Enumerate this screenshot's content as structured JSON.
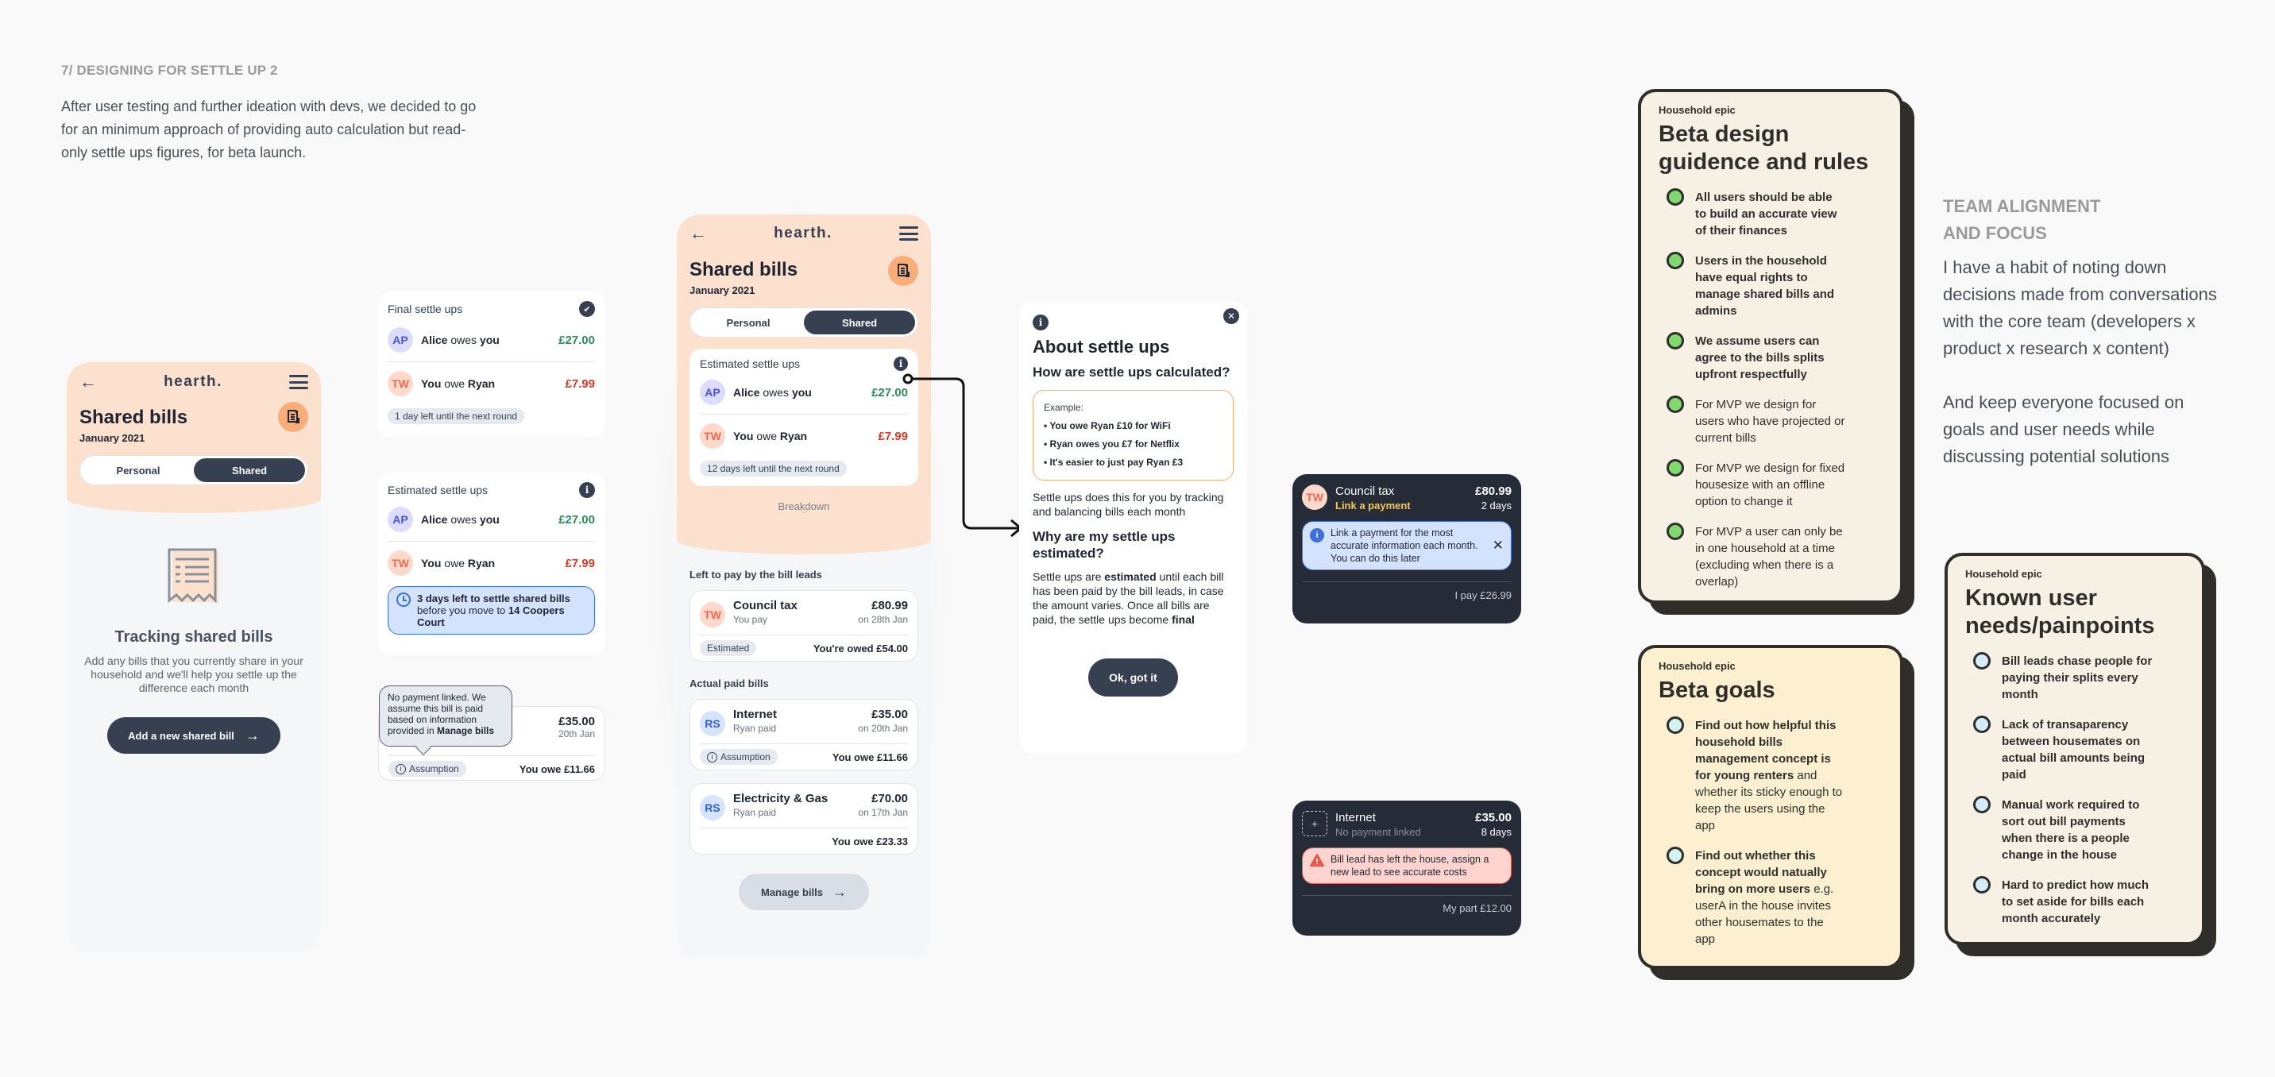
{
  "intro": {
    "title": "7/ DESIGNING FOR SETTLE UP 2",
    "body": "After user testing and further ideation with devs, we decided to go for an minimum approach of providing auto calculation but read-only settle ups figures, for beta launch."
  },
  "app": {
    "brand": "hearth.",
    "page_title": "Shared bills",
    "date": "January 2021",
    "tabs": [
      "Personal",
      "Shared"
    ],
    "active_tab": "Shared"
  },
  "empty_state": {
    "title": "Tracking shared bills",
    "body": "Add any bills that you currently share in your household and we'll help you settle up the difference each month",
    "cta": "Add a new shared bill"
  },
  "final_card": {
    "title": "Final settle ups",
    "rows": [
      {
        "initials": "AP",
        "name": "Alice",
        "verb": " owes ",
        "target": "you",
        "amount": "£27.00"
      },
      {
        "initials": "TW",
        "name": "You",
        "verb": " owe ",
        "target": "Ryan",
        "amount": "£7.99"
      }
    ],
    "pill": "1 day left until the next round"
  },
  "estimated_card": {
    "title": "Estimated settle ups",
    "rows": [
      {
        "initials": "AP",
        "name": "Alice",
        "verb": " owes ",
        "target": "you",
        "amount": "£27.00"
      },
      {
        "initials": "TW",
        "name": "You",
        "verb": " owe ",
        "target": "Ryan",
        "amount": "£7.99"
      }
    ],
    "notice_bold": "3 days left to settle shared bills",
    "notice_rest": " before you move to ",
    "notice_place": "14 Coopers Court"
  },
  "assumption_card": {
    "tooltip": "No payment linked. We assume this bill is paid based on information provided in ",
    "tooltip_bold": "Manage bills",
    "amount": "£35.00",
    "date": "20th Jan",
    "pill": "Assumption",
    "owe": "You owe £11.66"
  },
  "main_phone": {
    "estimated_title": "Estimated settle ups",
    "rows": [
      {
        "initials": "AP",
        "name": "Alice",
        "verb": " owes ",
        "target": "you",
        "amount": "£27.00"
      },
      {
        "initials": "TW",
        "name": "You",
        "verb": " owe ",
        "target": "Ryan",
        "amount": "£7.99"
      }
    ],
    "pill": "12 days left until the next round",
    "breakdown": "Breakdown",
    "section_left": "Left to pay by the bill leads",
    "section_paid": "Actual paid bills",
    "bills": [
      {
        "initials": "TW",
        "name": "Council tax",
        "sub": "You pay",
        "amount": "£80.99",
        "date": "on 28th Jan",
        "pill": "Estimated",
        "footer": "You're owed £54.00"
      },
      {
        "initials": "RS",
        "name": "Internet",
        "sub": "Ryan paid",
        "amount": "£35.00",
        "date": "on 20th Jan",
        "pill": "Assumption",
        "footer": "You owe £11.66"
      },
      {
        "initials": "RS",
        "name": "Electricity & Gas",
        "sub": "Ryan paid",
        "amount": "£70.00",
        "date": "on 17th Jan",
        "pill": "",
        "footer": "You owe £23.33"
      }
    ],
    "manage": "Manage bills"
  },
  "modal": {
    "title": "About settle ups",
    "q1": "How are settle ups calculated?",
    "example_label": "Example:",
    "examples": [
      "• You owe Ryan £10 for WiFi",
      "• Ryan owes you £7 for Netflix",
      "• It's easier to just pay Ryan £3"
    ],
    "a1": "Settle ups does this for you by tracking and balancing bills each month",
    "q2": "Why are my settle ups estimated?",
    "a2_1": "Settle ups are ",
    "a2_bold": "estimated",
    "a2_2": " until each bill has been paid by the bill leads, in case the amount varies. Once all bills are paid, the settle ups become ",
    "a2_final": "final",
    "button": "Ok, got it"
  },
  "dark_council": {
    "initials": "TW",
    "name": "Council tax",
    "link": "Link a payment",
    "amount": "£80.99",
    "days": "2 days",
    "info": "Link a payment for the most accurate information each month. You can do this later",
    "footer": "I pay £26.99"
  },
  "dark_internet": {
    "name": "Internet",
    "sub": "No payment linked",
    "amount": "£35.00",
    "days": "8 days",
    "warning": "Bill lead has left the house, assign a new lead to see accurate costs",
    "footer": "My part £12.00"
  },
  "epic_rules": {
    "tag": "Household epic",
    "title": "Beta design guidence and rules",
    "items": [
      {
        "bold": "All users should be able to build an accurate view of their finances",
        "rest": ""
      },
      {
        "bold": "Users in the household have equal rights to manage shared bills and admins",
        "rest": ""
      },
      {
        "bold": "We assume users can agree to the bills splits upfront respectfully",
        "rest": ""
      },
      {
        "bold": "",
        "rest": "For MVP we design for users who have projected or current bills"
      },
      {
        "bold": "",
        "rest": "For MVP we design for fixed housesize with an offline option to change it"
      },
      {
        "bold": "",
        "rest": "For MVP a user can only be in one household at a time (excluding when there is a overlap)"
      }
    ]
  },
  "epic_goals": {
    "tag": "Household epic",
    "title": "Beta goals",
    "items": [
      {
        "bold": "Find out how helpful this household bills management concept is for young renters",
        "rest": " and whether its sticky enough to keep the users using the app"
      },
      {
        "bold": "Find out whether this concept would natually bring on more users",
        "rest": " e.g. userA in the house invites other housemates to the app"
      }
    ]
  },
  "team": {
    "title_1": "TEAM ALIGNMENT",
    "title_2": "AND FOCUS",
    "p1": "I have a habit of noting down decisions made from conversations with the core team (developers x product x research x content)",
    "p2": "And keep everyone focused on goals and user needs while discussing potential solutions"
  },
  "epic_needs": {
    "tag": "Household epic",
    "title": "Known user needs/painpoints",
    "items": [
      "Bill leads chase people for paying their splits every month",
      "Lack of transaparency between housemates on actual bill amounts being paid",
      "Manual work required to sort out bill payments when there is a people change in the house",
      "Hard to predict how much to set aside for bills each month accurately"
    ]
  },
  "colors": {
    "peach": "#fde1cf",
    "navy": "#364050",
    "green": "#2e8b57",
    "red": "#d43a2a",
    "rule_dot": "#7fd870",
    "goal_dot": "#d3f2f2",
    "need_dot": "#d4ecfb"
  }
}
